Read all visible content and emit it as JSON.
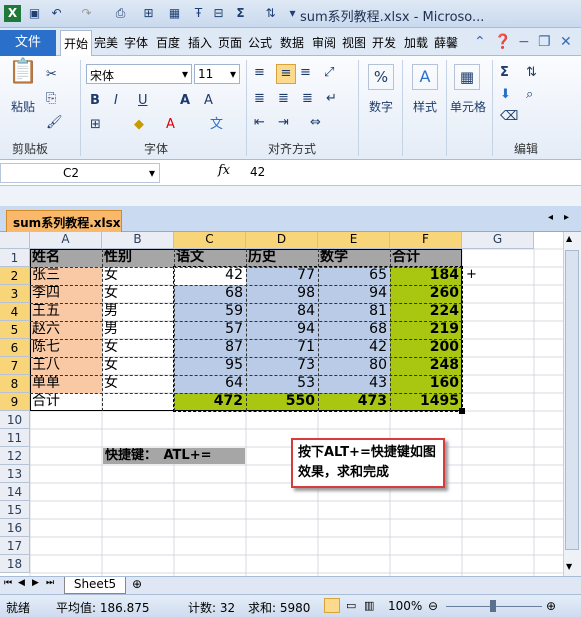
{
  "title_bar": {
    "title": "sum系列教程.xlsx - Microso..."
  },
  "ribbon_tabs": [
    "文件",
    "开始",
    "完美",
    "字体",
    "百度",
    "插入",
    "页面",
    "公式",
    "数据",
    "审阅",
    "视图",
    "开发",
    "加载",
    "薛馨"
  ],
  "ribbon": {
    "font_name": "宋体",
    "font_size": "11",
    "clipboard_paste": "粘贴",
    "clipboard_group": "剪贴板",
    "font_group": "字体",
    "align_group": "对齐方式",
    "number_label": "数字",
    "number_symbol": "%",
    "style_label": "样式",
    "style_symbol": "A",
    "cells_label": "单元格",
    "edit_group": "编辑"
  },
  "formula_bar": {
    "name_box": "C2",
    "fx": "fx",
    "value": "42"
  },
  "workbook_tab": "sum系列教程.xlsx",
  "columns": [
    "A",
    "B",
    "C",
    "D",
    "E",
    "F",
    "G"
  ],
  "rows": [
    "1",
    "2",
    "3",
    "4",
    "5",
    "6",
    "7",
    "8",
    "9",
    "10",
    "11",
    "12",
    "13",
    "14",
    "15",
    "16",
    "17",
    "18"
  ],
  "table": {
    "headers": [
      "姓名",
      "性别",
      "语文",
      "历史",
      "数学",
      "合计"
    ],
    "rows": [
      [
        "张三",
        "女",
        "42",
        "77",
        "65",
        "184"
      ],
      [
        "李四",
        "女",
        "68",
        "98",
        "94",
        "260"
      ],
      [
        "王五",
        "男",
        "59",
        "84",
        "81",
        "224"
      ],
      [
        "赵六",
        "男",
        "57",
        "94",
        "68",
        "219"
      ],
      [
        "陈七",
        "女",
        "87",
        "71",
        "42",
        "200"
      ],
      [
        "王八",
        "女",
        "95",
        "73",
        "80",
        "248"
      ],
      [
        "单单",
        "女",
        "64",
        "53",
        "43",
        "160"
      ]
    ],
    "total": [
      "合计",
      "",
      "472",
      "550",
      "473",
      "1495"
    ]
  },
  "shortcut_label": "快捷键：　ATL+=",
  "callout": "按下ALT+=快捷键如图效果，求和完成",
  "sheet_tab": "Sheet5",
  "status": {
    "ready": "就绪",
    "average": "平均值: 186.875",
    "count": "计数: 32",
    "sum": "求和: 5980",
    "zoom": "100%"
  },
  "colors": {
    "header_gray": "#a6a6a6",
    "name_orange": "#f9c9a6",
    "data_blue": "#b9cbe6",
    "sum_green": "#a9c711",
    "file_tab": "#2a6fc9"
  }
}
